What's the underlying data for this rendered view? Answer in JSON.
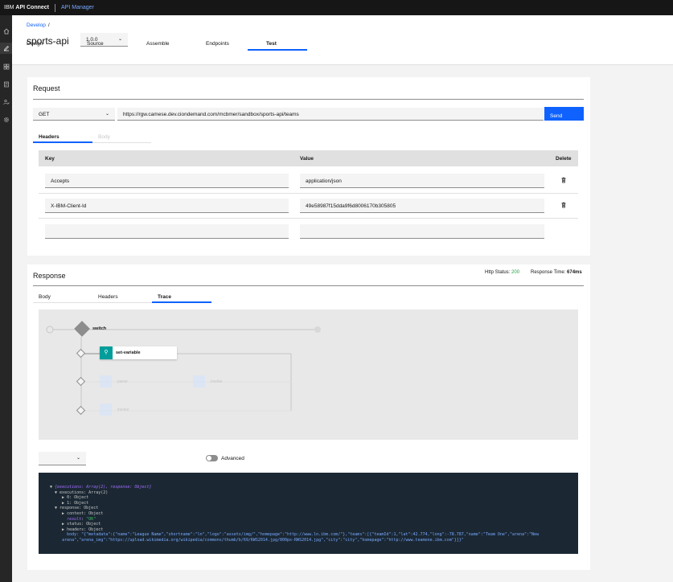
{
  "topbar": {
    "brand_prefix": "IBM ",
    "brand_bold": "API Connect",
    "product": "API Manager"
  },
  "nav": {
    "icons": [
      "home-icon",
      "edit-icon",
      "apps-icon",
      "catalog-icon",
      "users-icon",
      "settings-icon"
    ]
  },
  "header": {
    "breadcrumb": "Develop",
    "breadcrumb_sep": "/",
    "title": "sports-api",
    "version": "1.0.0",
    "tabs": [
      "Design",
      "Source",
      "Assemble",
      "Endpoints",
      "Test"
    ],
    "active_tab": "Test"
  },
  "request": {
    "title": "Request",
    "method": "GET",
    "url": "https://rgw.camese.dev.ciondemand.com/mcbmer/sandbox/sports-api/teams",
    "send_label": "Send",
    "tabs": [
      "Headers",
      "Body"
    ],
    "table": {
      "headers": [
        "Key",
        "Value",
        "Delete"
      ],
      "rows": [
        {
          "key": "Accepts",
          "value": "application/json"
        },
        {
          "key": "X-IBM-Client-Id",
          "value": "49e58987f15dda9f6d8006170b305805"
        },
        {
          "key": "",
          "value": ""
        }
      ]
    }
  },
  "response": {
    "title": "Response",
    "http_status_label": "Http Status:",
    "http_status": "200",
    "response_time_label": "Response Time:",
    "response_time": "674ms",
    "tabs": [
      "Body",
      "Headers",
      "Trace"
    ],
    "active_tab": "Trace",
    "trace": {
      "node_switch": "switch",
      "node_set_variable": "set-variable",
      "node_faint1": "parse",
      "node_faint2": "invoke",
      "node_faint3": "invoke"
    },
    "advanced_label": "Advanced",
    "code": {
      "l1_a": "{",
      "l1_k1": "executions",
      "l1_v1": ": Array(2), ",
      "l1_k2": "response",
      "l1_v2": ": Object}",
      "l2": "executions: Array(2)",
      "l3": "0: Object",
      "l4": "1: Object",
      "l5": "response: Object",
      "l6": "context: Object",
      "l7_k": "result",
      "l7_v": "\"OK\"",
      "l8": "status: Object",
      "l9": "headers: Object",
      "l10": "body: \"{\"metadata\":{\"name\":\"League Name\",\"shortname\":\"ln\",\"logo\":\"assets/img/\",\"homepage\":\"http://www.ln.ibm.com/\"},\"teams\":[{\"teamId\":1,\"lat\":42.774,\"long\":-78.787,\"name\":\"Team One\",\"arena\":\"New",
      "l11": "arena\",\"arena_img\":\"https://upload.wikimedia.org/wikipedia/commons/thumb/b/69/RWS2014.jpg/800px-RWS2014.jpg\",\"city\":\"city\",\"homepage\":\"http://www.teamone.ibm.com\"}]}\""
    }
  },
  "colors": {
    "accent": "#0f62fe",
    "status_ok": "#24a148",
    "topbar": "#161616",
    "code_bg": "#1b2834",
    "teal": "#009d9a"
  }
}
